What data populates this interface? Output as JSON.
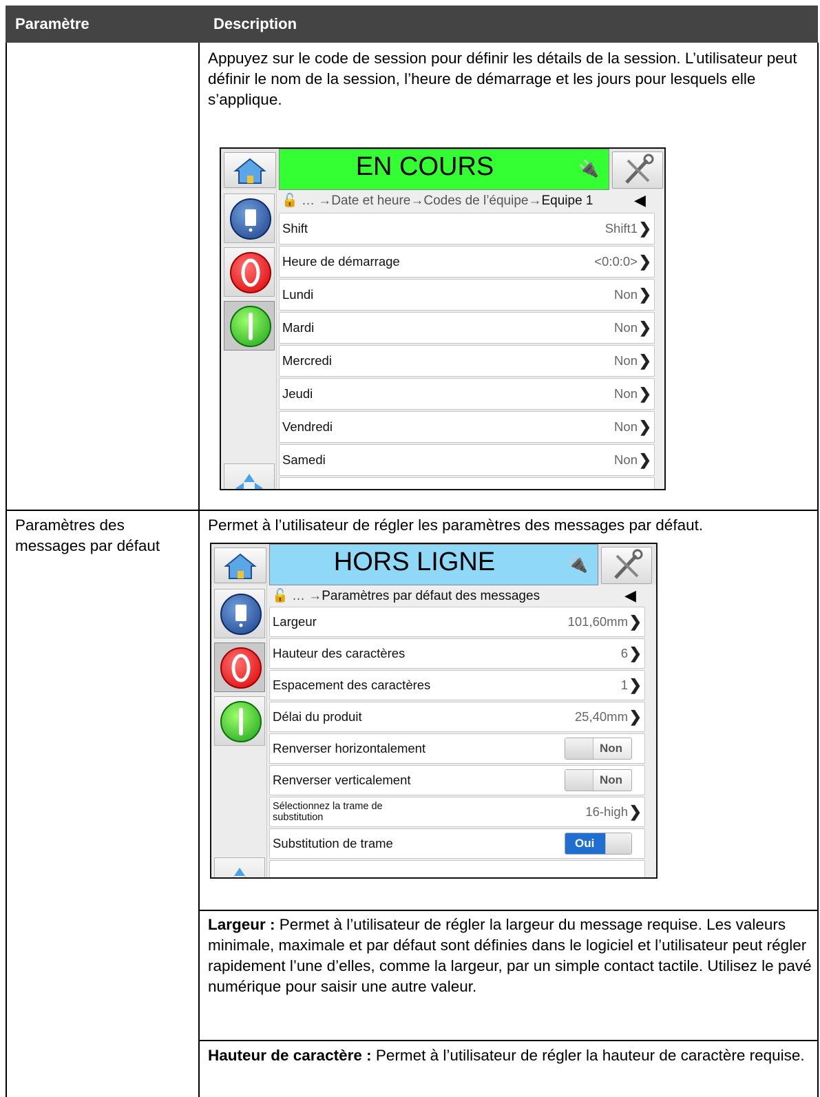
{
  "table": {
    "col1_header": "Paramètre",
    "col2_header": "Description"
  },
  "row1": {
    "desc": "Appuyez sur le code de session pour définir les détails de la session. L’utilisateur peut définir le nom de la session, l’heure de démarrage et les jours pour lesquels elle s’applique.",
    "device": {
      "status": "EN COURS",
      "status_color": "#33ff33",
      "breadcrumb_lead": "… →Date et heure→Codes de l’équipe→",
      "breadcrumb_current": "Equipe 1",
      "rows": [
        {
          "label": "Shift",
          "value": "Shift1"
        },
        {
          "label": "Heure de démarrage",
          "value": "<0:0:0>"
        },
        {
          "label": "Lundi",
          "value": "Non"
        },
        {
          "label": "Mardi",
          "value": "Non"
        },
        {
          "label": "Mercredi",
          "value": "Non"
        },
        {
          "label": "Jeudi",
          "value": "Non"
        },
        {
          "label": "Vendredi",
          "value": "Non"
        },
        {
          "label": "Samedi",
          "value": "Non"
        }
      ]
    }
  },
  "row2": {
    "param": "Paramètres des messages par défaut",
    "desc": "Permet à l’utilisateur de régler les paramètres des messages par défaut.",
    "device": {
      "status": "HORS LIGNE",
      "status_color": "#8fd8f8",
      "breadcrumb_lead": "… →",
      "breadcrumb_current": "Paramètres par défaut des messages",
      "rows": [
        {
          "label": "Largeur",
          "value": "101,60mm"
        },
        {
          "label": "Hauteur des caractères",
          "value": "6"
        },
        {
          "label": "Espacement des caractères",
          "value": "1"
        },
        {
          "label": "Délai du produit",
          "value": "25,40mm"
        },
        {
          "label": "Renverser horizontalement",
          "toggle": "Non"
        },
        {
          "label": "Renverser verticalement",
          "toggle": "Non"
        },
        {
          "label": "Sélectionnez la trame de substitution",
          "value": "16-high"
        },
        {
          "label": "Substitution de trame",
          "toggle": "Oui"
        }
      ]
    }
  },
  "row3": {
    "bold": "Largeur :",
    "text": " Permet à l’utilisateur de régler la largeur du message requise. Les valeurs minimale, maximale et par défaut sont définies dans le logiciel et l’utilisateur peut régler rapidement l’une d’elles, comme la largeur, par un simple contact tactile. Utilisez le pavé numérique pour saisir une autre valeur."
  },
  "row4": {
    "bold": "Hauteur de caractère :",
    "text": " Permet à l’utilisateur de régler la hauteur de caractère requise."
  },
  "colors": {
    "header_bg": "#444444",
    "on_toggle": "#1f6fd0"
  }
}
